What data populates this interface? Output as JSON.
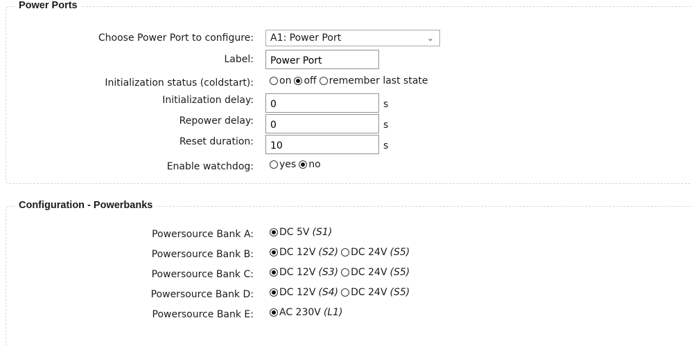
{
  "power_ports": {
    "legend": "Power Ports",
    "choose_label": "Choose Power Port to configure:",
    "choose_value": "A1: Power Port",
    "label_label": "Label:",
    "label_value": "Power Port",
    "init_status_label": "Initialization status (coldstart):",
    "init_status_options": [
      "on",
      "off",
      "remember last state"
    ],
    "init_status_selected": "off",
    "init_delay_label": "Initialization delay:",
    "init_delay_value": "0",
    "repower_delay_label": "Repower delay:",
    "repower_delay_value": "0",
    "reset_duration_label": "Reset duration:",
    "reset_duration_value": "10",
    "unit": "s",
    "watchdog_label": "Enable watchdog:",
    "watchdog_options": [
      "yes",
      "no"
    ],
    "watchdog_selected": "no"
  },
  "powerbanks": {
    "legend": "Configuration - Powerbanks",
    "banks": [
      {
        "label": "Powersource Bank A:",
        "opt1": "DC 5V",
        "opt1_code": "(S1)",
        "opt2": "",
        "opt2_code": ""
      },
      {
        "label": "Powersource Bank B:",
        "opt1": "DC 12V",
        "opt1_code": "(S2)",
        "opt2": "DC 24V",
        "opt2_code": "(S5)"
      },
      {
        "label": "Powersource Bank C:",
        "opt1": "DC 12V",
        "opt1_code": "(S3)",
        "opt2": "DC 24V",
        "opt2_code": "(S5)"
      },
      {
        "label": "Powersource Bank D:",
        "opt1": "DC 12V",
        "opt1_code": "(S4)",
        "opt2": "DC 24V",
        "opt2_code": "(S5)"
      },
      {
        "label": "Powersource Bank E:",
        "opt1": "AC 230V",
        "opt1_code": "(L1)",
        "opt2": "",
        "opt2_code": ""
      }
    ]
  },
  "icons": {
    "dropdown": "chevron-down-icon",
    "radio": "radio-button-icon"
  }
}
